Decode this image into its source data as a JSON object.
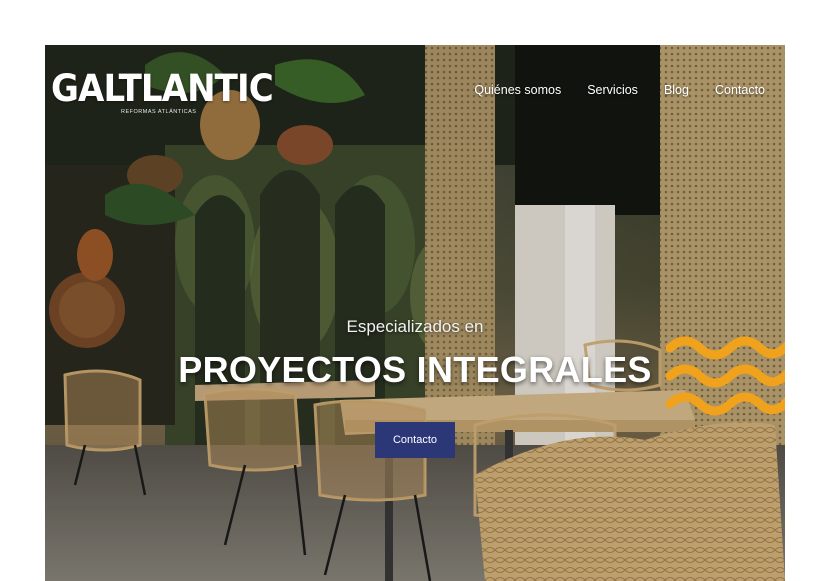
{
  "brand": {
    "name": "GALTLANTIC",
    "tagline": "REFORMAS ATLÁNTICAS"
  },
  "nav": {
    "items": [
      {
        "label": "Quiénes somos"
      },
      {
        "label": "Servicios"
      },
      {
        "label": "Blog"
      },
      {
        "label": "Contacto"
      }
    ]
  },
  "hero": {
    "subtitle": "Especializados en",
    "headline": "PROYECTOS INTEGRALES",
    "cta_label": "Contacto"
  },
  "colors": {
    "accent_wave": "#f0a21c",
    "cta_bg": "#2c3778",
    "text": "#ffffff"
  },
  "icons": [
    "wave-decoration-icon",
    "brand-logo"
  ]
}
